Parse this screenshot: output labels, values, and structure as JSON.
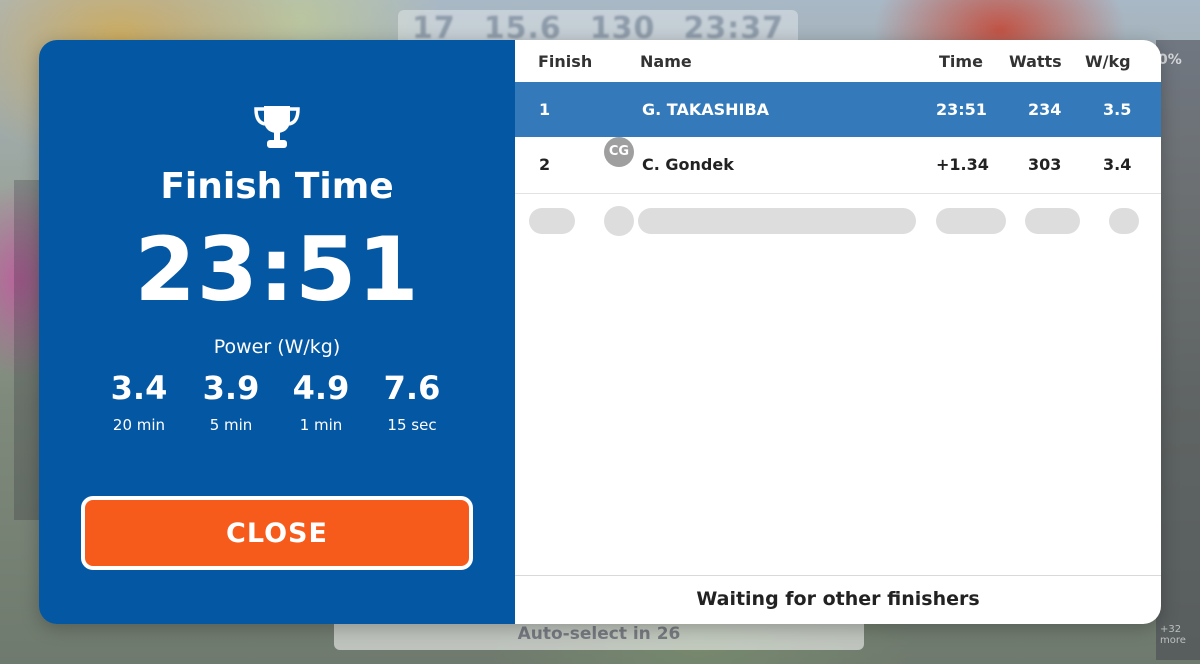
{
  "background": {
    "hud_values": [
      "17",
      "15.6",
      "130",
      "23:37"
    ],
    "right_top": "0%",
    "right_bottom": "+32 more",
    "bottom_bar": "Auto-select in 26"
  },
  "summary": {
    "finish_label": "Finish Time",
    "finish_time": "23:51",
    "power_label": "Power (W/kg)",
    "power_stats": [
      {
        "value": "3.4",
        "label": "20 min"
      },
      {
        "value": "3.9",
        "label": "5 min"
      },
      {
        "value": "4.9",
        "label": "1 min"
      },
      {
        "value": "7.6",
        "label": "15 sec"
      }
    ],
    "close_label": "CLOSE"
  },
  "results": {
    "columns": {
      "finish": "Finish",
      "name": "Name",
      "time": "Time",
      "watts": "Watts",
      "wkg": "W/kg"
    },
    "rows": [
      {
        "finish": "1",
        "avatar": "",
        "name": "G. TAKASHIBA",
        "time": "23:51",
        "watts": "234",
        "wkg": "3.5",
        "highlighted": true
      },
      {
        "finish": "2",
        "avatar": "CG",
        "name": "C. Gondek",
        "time": "+1.34",
        "watts": "303",
        "wkg": "3.4",
        "highlighted": false
      }
    ],
    "footer": "Waiting for other finishers"
  },
  "colors": {
    "panel_blue": "#0457a3",
    "row_highlight": "#3479ba",
    "close_button": "#f75b1b",
    "avatar_gray": "#9f9f9f"
  },
  "icons": {
    "trophy": "trophy-icon"
  }
}
